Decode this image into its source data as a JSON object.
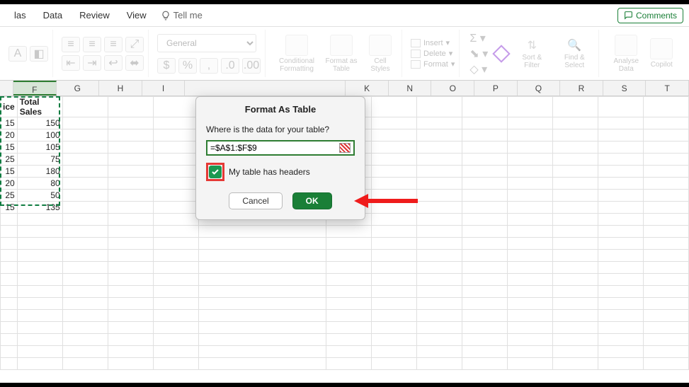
{
  "menubar": {
    "tabs": [
      "las",
      "Data",
      "Review",
      "View"
    ],
    "tellme": "Tell me",
    "comments": "Comments"
  },
  "ribbon": {
    "number_format": "General",
    "cond_fmt": "Conditional Formatting",
    "fmt_table": "Format as Table",
    "cell_styles": "Cell Styles",
    "insert": "Insert",
    "delete": "Delete",
    "format": "Format",
    "sort": "Sort & Filter",
    "find": "Find & Select",
    "analyse": "Analyse Data",
    "copilot": "Copilot"
  },
  "columns": [
    "F",
    "G",
    "H",
    "I",
    "",
    "K",
    "",
    "",
    "N",
    "O",
    "P",
    "Q",
    "R",
    "S",
    "T"
  ],
  "sheet": {
    "header_e": "ice",
    "header_f": "Total Sales",
    "rows": [
      {
        "e": "15",
        "f": "150"
      },
      {
        "e": "20",
        "f": "100"
      },
      {
        "e": "15",
        "f": "105"
      },
      {
        "e": "25",
        "f": "75"
      },
      {
        "e": "15",
        "f": "180"
      },
      {
        "e": "20",
        "f": "80"
      },
      {
        "e": "25",
        "f": "50"
      },
      {
        "e": "15",
        "f": "135"
      }
    ]
  },
  "dialog": {
    "title": "Format As Table",
    "question": "Where is the data for your table?",
    "range": "=$A$1:$F$9",
    "checkbox": "My table has headers",
    "cancel": "Cancel",
    "ok": "OK"
  }
}
